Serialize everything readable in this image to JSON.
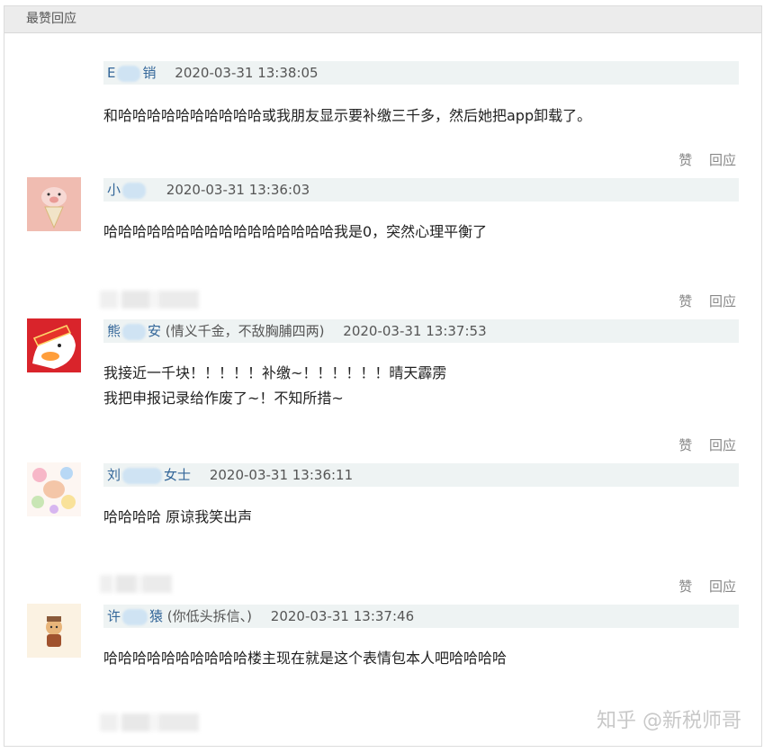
{
  "header": {
    "title": "最赞回应"
  },
  "actions": {
    "like": "赞",
    "reply": "回应"
  },
  "comments": [
    {
      "name_start": "E",
      "name_end": "销",
      "signature": "",
      "time": "2020-03-31 13:38:05",
      "lines": [
        "和哈哈哈哈哈哈哈哈哈哈或我朋友显示要补缴三千多，然后她把app卸载了。"
      ]
    },
    {
      "name_start": "小",
      "name_end": "",
      "signature": "",
      "time": "2020-03-31 13:36:03",
      "lines": [
        "哈哈哈哈哈哈哈哈哈哈哈哈哈哈哈哈我是0，突然心理平衡了"
      ]
    },
    {
      "name_start": "熊",
      "name_end": "安",
      "signature": " (情义千金，不敌胸脯四两)",
      "time": "2020-03-31 13:37:53",
      "lines": [
        "我接近一千块！！！！！补缴~！！！！！！晴天霹雳",
        "我把申报记录给作废了~！不知所措~"
      ]
    },
    {
      "name_start": "刘",
      "name_end": "女士",
      "signature": "",
      "time": "2020-03-31 13:36:11",
      "lines": [
        "哈哈哈哈 原谅我笑出声"
      ]
    },
    {
      "name_start": "许",
      "name_end": "猿",
      "signature": " (你低头拆信、)",
      "time": "2020-03-31 13:37:46",
      "lines": [
        "哈哈哈哈哈哈哈哈哈哈楼主现在就是这个表情包本人吧哈哈哈哈"
      ]
    }
  ],
  "watermark": "知乎 @新税师哥"
}
